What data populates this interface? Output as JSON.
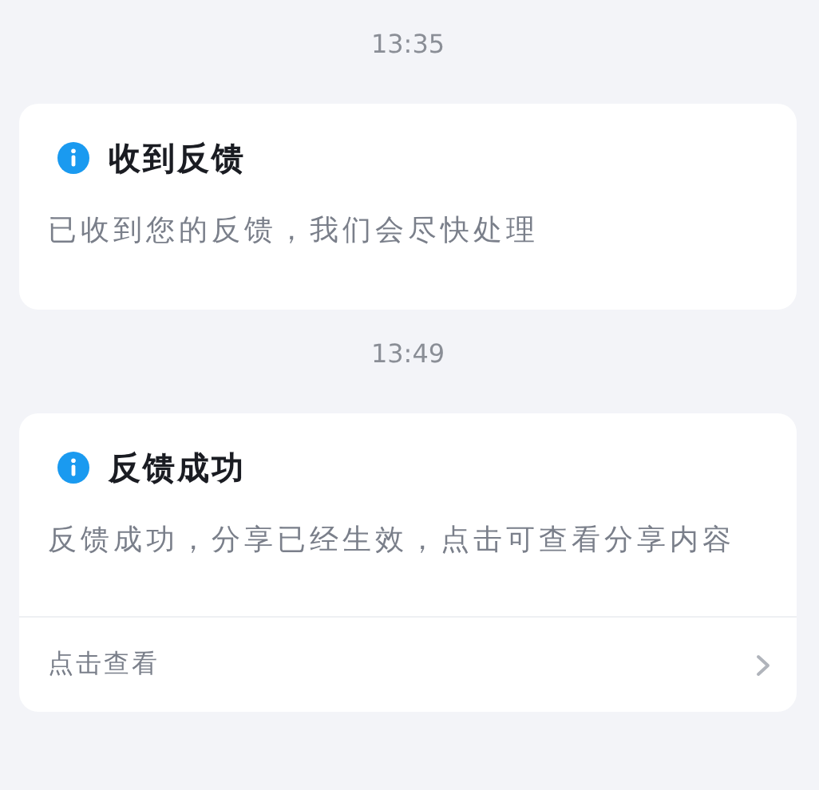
{
  "messages": [
    {
      "time": "13:35",
      "card": {
        "title": "收到反馈",
        "body": "已收到您的反馈，我们会尽快处理"
      }
    },
    {
      "time": "13:49",
      "card": {
        "title": "反馈成功",
        "body": "反馈成功，分享已经生效，点击可查看分享内容",
        "link": "点击查看"
      }
    }
  ]
}
